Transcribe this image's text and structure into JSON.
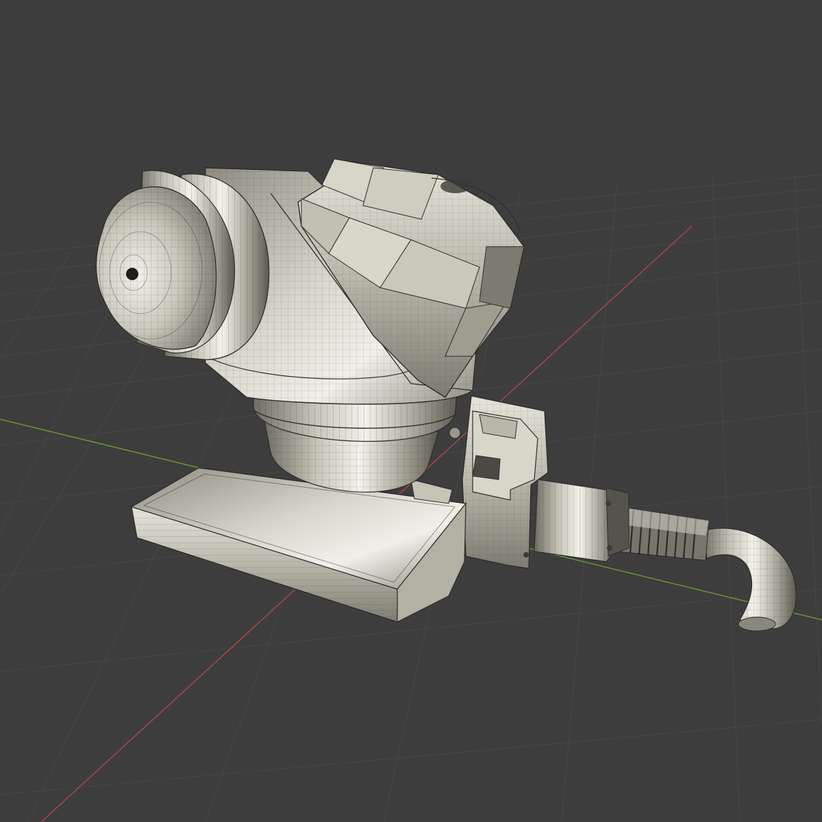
{
  "viewport": {
    "background": "#3d3d3d",
    "grid_color": "#4a4a4a",
    "x_axis_color": "#c9505a",
    "y_axis_color": "#7aa83a",
    "wire_color": "#2a2a28",
    "model_base_color": "#a8a598",
    "model_highlight_color": "#e9e6dc"
  },
  "model": {
    "parts": [
      "sensor-head",
      "dome-cap",
      "swivel-neck",
      "rail-bracket",
      "mount-block",
      "bellows-hose",
      "elbow-pipe"
    ]
  }
}
